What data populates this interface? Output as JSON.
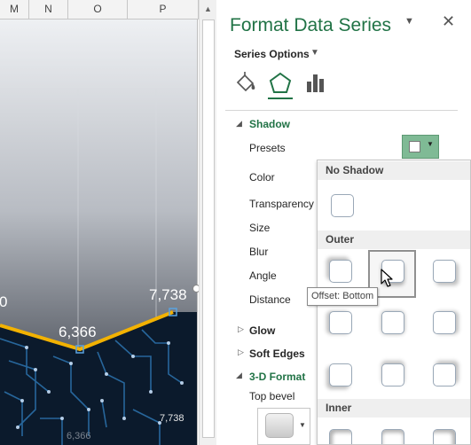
{
  "sheet": {
    "columns": [
      "M",
      "N",
      "O",
      "P"
    ],
    "chart": {
      "labels": {
        "left_partial": "0",
        "mid": "6,366",
        "right": "7,738",
        "lower_right": "7,738",
        "lower_mid": "6,366"
      }
    }
  },
  "pane": {
    "title": "Format Data Series",
    "series_options": "Series Options",
    "shadow": {
      "title": "Shadow",
      "presets": "Presets",
      "color": "Color",
      "transparency": "Transparency",
      "size": "Size",
      "blur": "Blur",
      "angle": "Angle",
      "distance": "Distance"
    },
    "glow": "Glow",
    "soft_edges": "Soft Edges",
    "format_3d": "3-D Format",
    "top_bevel": "Top bevel"
  },
  "gallery": {
    "no_shadow": "No Shadow",
    "outer": "Outer",
    "inner": "Inner",
    "tooltip": "Offset: Bottom"
  },
  "colors": {
    "accent": "#217346",
    "line": "#f2b202",
    "preset_button": "#7fba95"
  }
}
